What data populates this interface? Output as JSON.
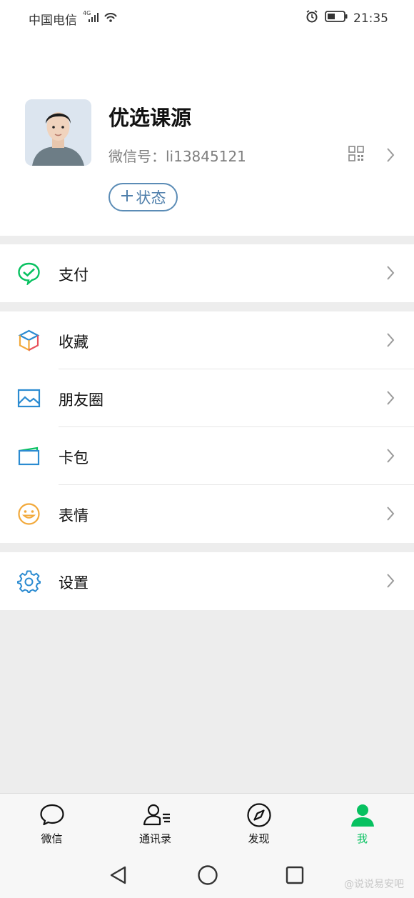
{
  "status_bar": {
    "carrier": "中国电信",
    "network": "4G",
    "time": "21:35",
    "icons": [
      "signal-icon",
      "wifi-icon",
      "alarm-icon",
      "battery-icon"
    ]
  },
  "profile": {
    "name": "优选课源",
    "wechat_id": "微信号：li13845121",
    "status_button": "状态",
    "status_button_icon": "plus-icon",
    "qr_icon": "qr-code-icon"
  },
  "menu_groups": [
    {
      "items": [
        {
          "label": "支付",
          "icon": "pay-icon",
          "color": "#07c160"
        }
      ]
    },
    {
      "items": [
        {
          "label": "收藏",
          "icon": "favorites-cube-icon",
          "color": "#f2a93b"
        },
        {
          "label": "朋友圈",
          "icon": "moments-image-icon",
          "color": "#2b8bd1"
        },
        {
          "label": "卡包",
          "icon": "card-wallet-icon",
          "color": "#2b8bd1"
        },
        {
          "label": "表情",
          "icon": "emoji-icon",
          "color": "#f2a93b"
        }
      ]
    },
    {
      "items": [
        {
          "label": "设置",
          "icon": "settings-gear-icon",
          "color": "#2b8bd1"
        }
      ]
    }
  ],
  "tab_bar": {
    "tabs": [
      {
        "label": "微信",
        "icon": "chat-bubble-icon"
      },
      {
        "label": "通讯录",
        "icon": "contacts-icon"
      },
      {
        "label": "发现",
        "icon": "compass-icon"
      },
      {
        "label": "我",
        "icon": "me-person-icon",
        "active": true
      }
    ],
    "active_color": "#07c160"
  },
  "system_nav": {
    "buttons": [
      "back-triangle-icon",
      "home-circle-icon",
      "recents-square-icon"
    ],
    "watermark": "@说说易安吧"
  }
}
